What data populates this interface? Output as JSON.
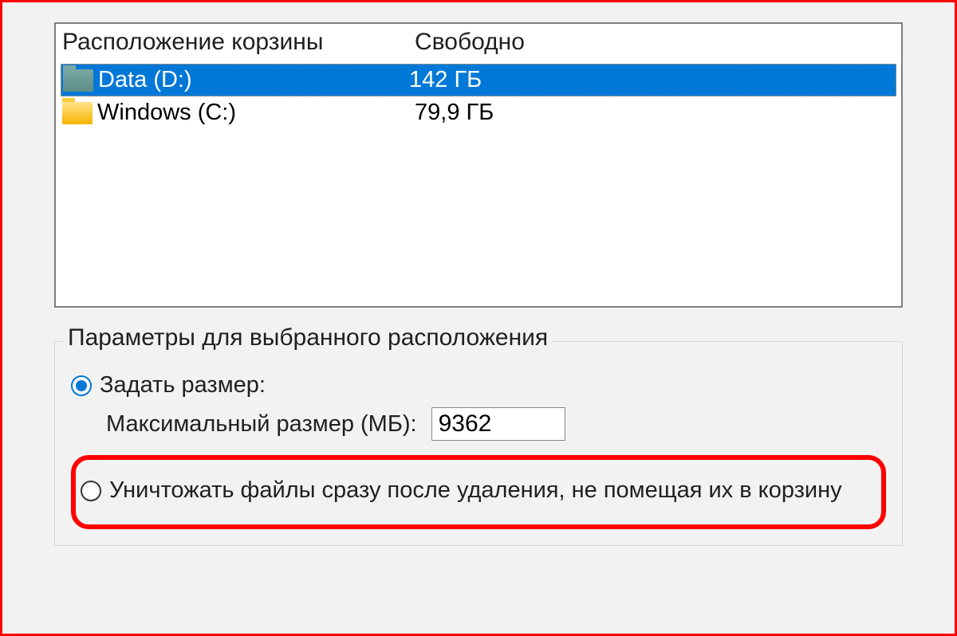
{
  "listview": {
    "headers": {
      "location": "Расположение корзины",
      "free": "Свободно"
    },
    "rows": [
      {
        "name": "Data (D:)",
        "free": "142 ГБ",
        "selected": true,
        "icon": "teal"
      },
      {
        "name": "Windows (C:)",
        "free": "79,9 ГБ",
        "selected": false,
        "icon": "yellow"
      }
    ]
  },
  "fieldset": {
    "legend": "Параметры для выбранного расположения",
    "option_custom_size": {
      "label": "Задать размер:",
      "sublabel": "Максимальный размер (МБ):",
      "value": "9362",
      "checked": true
    },
    "option_delete_immediately": {
      "label": "Уничтожать файлы сразу после удаления, не помещая их в корзину",
      "checked": false
    }
  }
}
